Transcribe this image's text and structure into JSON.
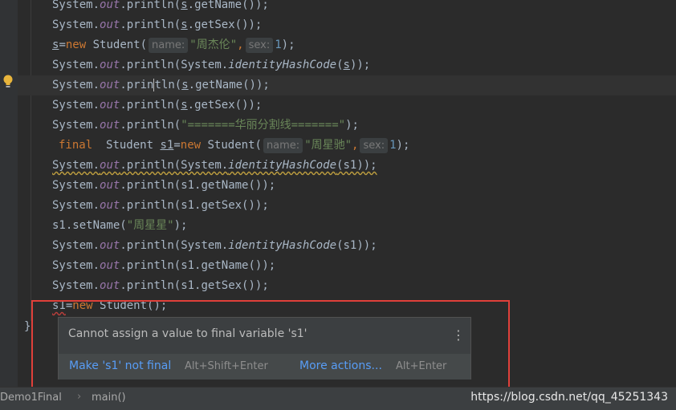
{
  "editor": {
    "lines": [
      {
        "recv": "System",
        "field": "out",
        "call": "println",
        "arg_var": "s",
        "arg_method": ".getName()",
        "tail": ");"
      },
      {
        "recv": "System",
        "field": "out",
        "call": "println",
        "arg_var": "s",
        "arg_method": ".getSex()",
        "tail": ");"
      },
      {
        "var": "s",
        "eq": "=",
        "kw_new": "new",
        "cls": "Student(",
        "hint1": "name:",
        "str1": "\"周杰伦\"",
        "comma": ",",
        "hint2": "sex:",
        "num": "1",
        "tail": ");"
      },
      {
        "recv": "System",
        "field": "out",
        "call": "println",
        "inner": "(System.",
        "method": "identityHashCode",
        "arg": "s",
        "tail": "));"
      },
      {
        "recv": "System",
        "field": "out",
        "call_a": "prin",
        "call_b": "tln",
        "arg_var": "s",
        "arg_method": ".getName()",
        "tail": ");"
      },
      {
        "recv": "System",
        "field": "out",
        "call": "println",
        "arg_var": "s",
        "arg_method": ".getSex()",
        "tail": ");"
      },
      {
        "recv": "System",
        "field": "out",
        "call": "println",
        "str": "\"=======华丽分割线=======\"",
        "tail": ");"
      },
      {
        "kw_final": "final",
        "type": "Student",
        "var": "s1",
        "eq": "=",
        "kw_new": "new",
        "cls": "Student(",
        "hint1": "name:",
        "str1": "\"周星驰\"",
        "comma": ",",
        "hint2": "sex:",
        "num": "1",
        "tail": ");"
      },
      {
        "text_a": "System.",
        "field": "out",
        "text_b": ".println(System.",
        "method": "identityHashCode",
        "text_c": "(s1));"
      },
      {
        "recv": "System",
        "field": "out",
        "call": "println",
        "arg": "(s1.getName()",
        "tail": ");"
      },
      {
        "recv": "System",
        "field": "out",
        "call": "println",
        "arg": "(s1.getSex()",
        "tail": ");"
      },
      {
        "code": "s1.setName(",
        "str": "\"周星星\"",
        "tail": ");"
      },
      {
        "recv": "System",
        "field": "out",
        "call": "println",
        "inner": "(System.",
        "method": "identityHashCode",
        "arg": "s1",
        "tail": "));"
      },
      {
        "recv": "System",
        "field": "out",
        "call": "println",
        "arg": "(s1.getName()",
        "tail": ");"
      },
      {
        "recv": "System",
        "field": "out",
        "call": "println",
        "arg": "(s1.getSex()",
        "tail": ");"
      },
      {
        "var": "s1",
        "eq": "=",
        "kw_new": "new",
        "code": "Student()",
        "tail": ";"
      }
    ],
    "closing_brace": "}"
  },
  "popup": {
    "message": "Cannot assign a value to final variable 's1'",
    "menu_icon": "more-vertical-icon",
    "action1_label": "Make 's1' not final",
    "action1_shortcut": "Alt+Shift+Enter",
    "action2_label": "More actions...",
    "action2_shortcut": "Alt+Enter"
  },
  "statusbar": {
    "file": "Demo1Final",
    "method": "main()",
    "separator": "›"
  },
  "watermark": "https://blog.csdn.net/qq_45251343",
  "colors": {
    "background": "#2b2b2b",
    "keyword": "#cc7832",
    "field": "#9876aa",
    "string": "#6a8759",
    "number": "#6897bb",
    "link": "#589df6",
    "highlight_box": "#e0403a"
  }
}
